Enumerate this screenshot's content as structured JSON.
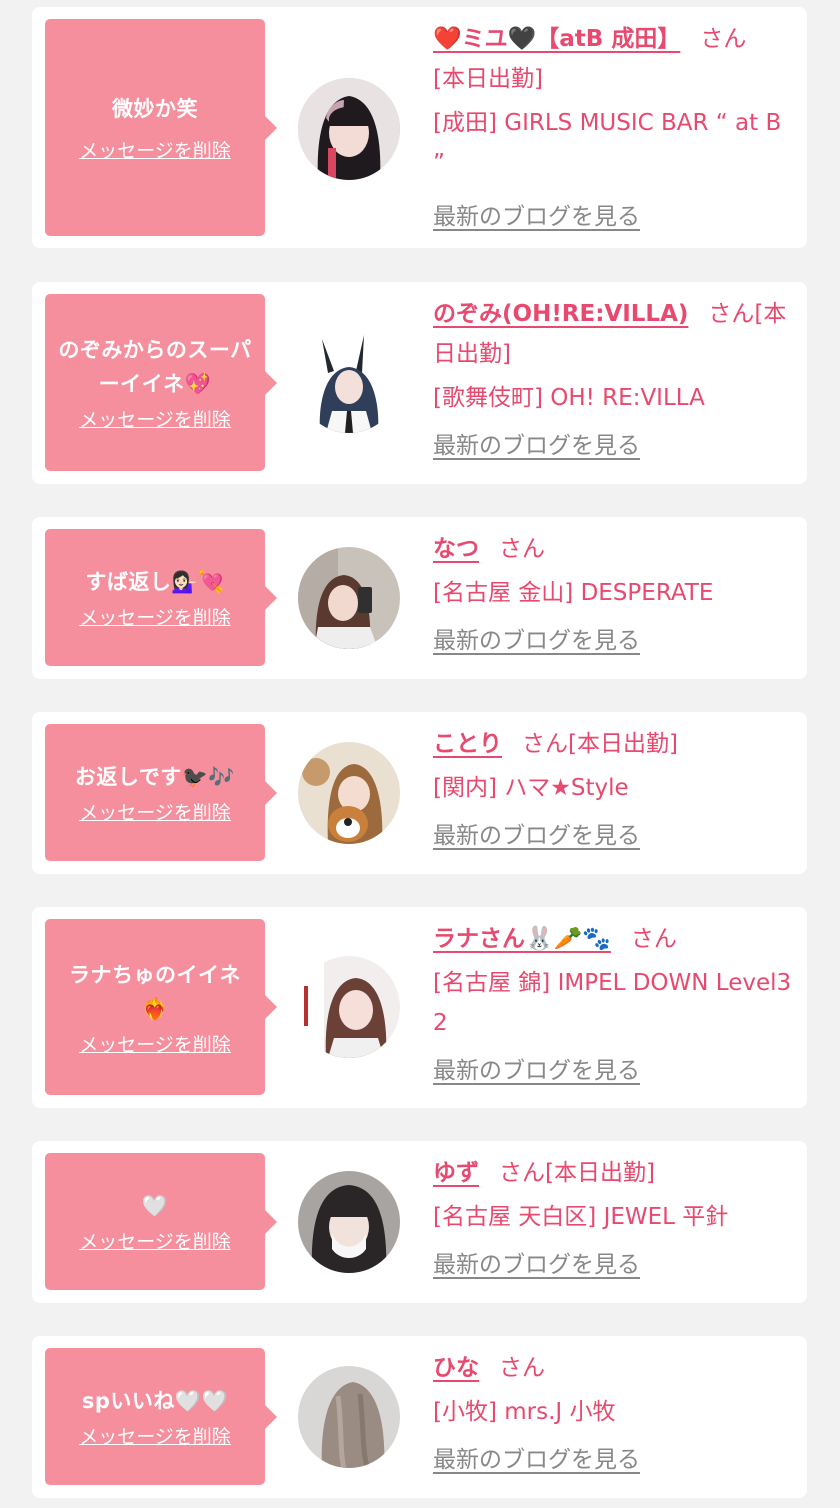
{
  "delete_label": "メッセージを削除",
  "blog_label": "最新のブログを見る",
  "san_suffix": "さん",
  "accent_color": "#e8496e",
  "bubble_color": "#f58f9d",
  "items": [
    {
      "message": "微妙か笑",
      "name": "❤️ミユ🖤【atB 成田】",
      "status": "",
      "status_line": "[本日出勤]",
      "shop": "[成田] GIRLS MUSIC BAR “ at B ”"
    },
    {
      "message": "のぞみからのスーパーイイネ💖",
      "name": "のぞみ(OH!RE:VILLA)",
      "status": "[本日出勤]",
      "status_line": "",
      "shop": "[歌舞伎町] OH! RE:VILLA"
    },
    {
      "message": "すば返し💁🏻‍♀️💘",
      "name": "なつ",
      "status": "",
      "status_line": "",
      "shop": "[名古屋 金山] DESPERATE"
    },
    {
      "message": "お返しです🐦‍⬛🎶",
      "name": "ことり",
      "status": "[本日出勤]",
      "status_line": "",
      "shop": "[関内] ハマ★Style"
    },
    {
      "message": "ラナちゅのイイネ❤️‍🔥",
      "name": "ラナさん🐰🥕🐾",
      "status": "",
      "status_line": "",
      "shop": "[名古屋 錦] IMPEL DOWN Level32"
    },
    {
      "message": "🤍",
      "name": "ゆず",
      "status": "[本日出勤]",
      "status_line": "",
      "shop": "[名古屋 天白区] JEWEL 平針"
    },
    {
      "message": "spいいね🤍🤍",
      "name": "ひな",
      "status": "",
      "status_line": "",
      "shop": "[小牧] mrs.J 小牧"
    }
  ]
}
